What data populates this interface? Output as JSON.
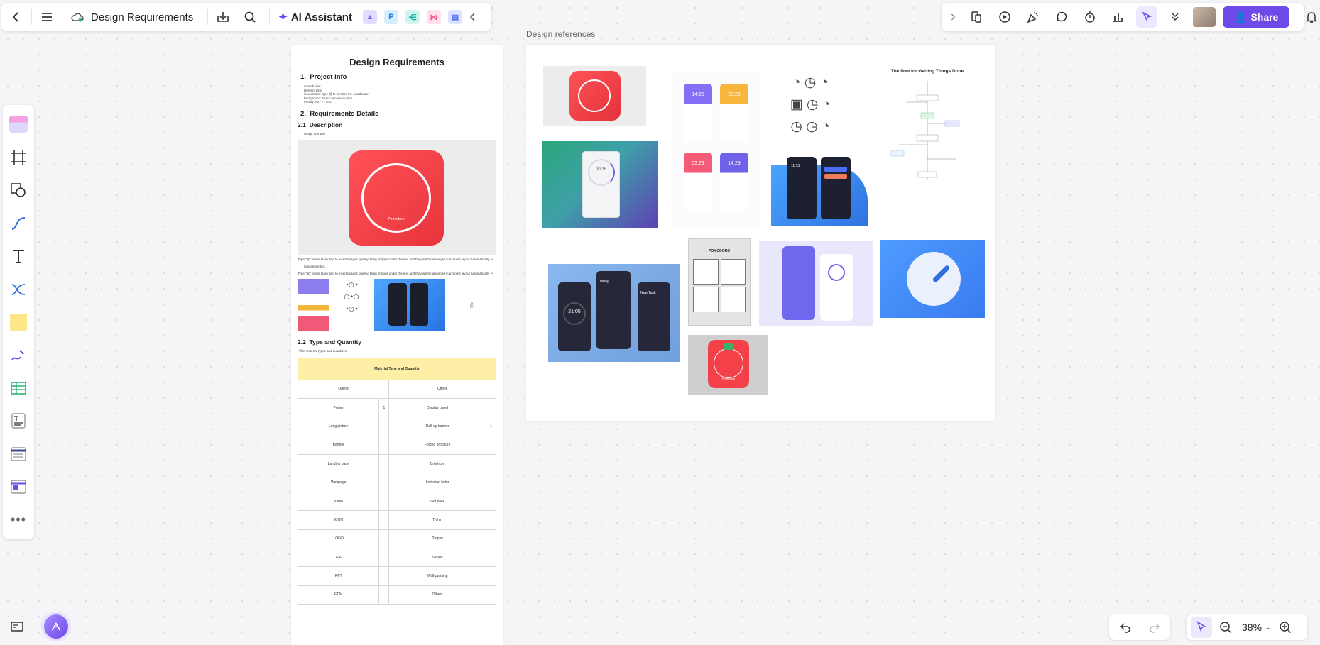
{
  "toolbar": {
    "doc_title": "Design Requirements",
    "ai_assistant": "AI Assistant",
    "share": "Share",
    "ai_tiles": [
      "P"
    ]
  },
  "zoom": {
    "level": "38%"
  },
  "board_label": "Design references",
  "doc": {
    "title": "Design Requirements",
    "sections": {
      "s1": {
        "num": "1.",
        "title": "Project Info"
      },
      "s2": {
        "num": "2.",
        "title": "Requirements Details"
      },
      "s21": {
        "num": "2.1",
        "title": "Description"
      },
      "s22": {
        "num": "2.2",
        "title": "Type and Quantity"
      }
    },
    "info_list": [
      "Launch time:",
      "Delivery time:",
      "Coordinator: Type @ to mention the coordinator",
      "Background: Attach necessary docs",
      "Priority: P0 / P1 / P2"
    ],
    "usage_bullet": "Usage scenario",
    "expected_bullet": "Expected effect",
    "hint_text": "Type \"/tp\" in the blank line to insert images quickly. Drag images under the text and they will be arranged in a mixed layout automatically ↩.",
    "hint_text_2": "Type \"/tp\" in the blank line to insert images quickly. Drag images under the text and they will be arranged in a mixed layout automatically ↩.",
    "fill_hint": "Fill in material types and quantities",
    "pomodoro_label": "Pomodoro",
    "table": {
      "title": "Material Type and Quantity",
      "online": "Online",
      "offline": "Offline",
      "rows": [
        [
          "Poster",
          "1",
          "Display panel",
          ""
        ],
        [
          "Long picture",
          "",
          "Roll-up banner",
          "1"
        ],
        [
          "Banner",
          "",
          "Folded brochure",
          ""
        ],
        [
          "Landing page",
          "",
          "Brochure",
          ""
        ],
        [
          "Webpage",
          "",
          "Invitation letter",
          ""
        ],
        [
          "Video",
          "",
          "Gift pack",
          ""
        ],
        [
          "ICON",
          "",
          "T-shirt",
          ""
        ],
        [
          "LOGO",
          "",
          "Trophy",
          ""
        ],
        [
          "GIF",
          "",
          "Sticker",
          ""
        ],
        [
          "PPT",
          "",
          "Wall-painting",
          ""
        ],
        [
          "EDM",
          "",
          "Others",
          ""
        ]
      ]
    }
  },
  "refs": {
    "flow_title": "The flow for Getting Things Done",
    "timer_1": "00:15",
    "times": [
      "14:25",
      "20:25",
      "03:29",
      "14:29"
    ],
    "dark_time": "21:05",
    "dark_small": "11:15",
    "new_task": "New Task",
    "today": "Today",
    "comic_title": "POMODORO",
    "pomodoro_tomato": "Pomodoro"
  },
  "colors": {
    "accent": "#6e4ae8",
    "red": "#f4434b",
    "blue": "#3a7bf0"
  }
}
